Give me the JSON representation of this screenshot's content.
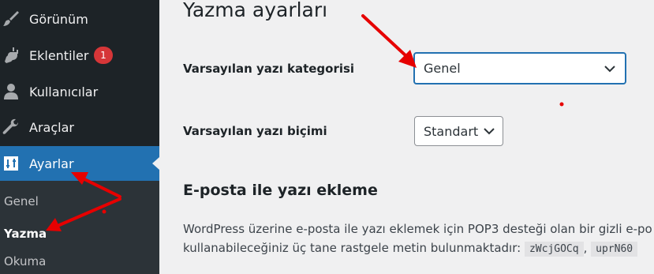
{
  "sidebar": {
    "items": [
      {
        "label": "Görünüm",
        "icon": "paintbrush-icon"
      },
      {
        "label": "Eklentiler",
        "icon": "plugin-icon",
        "badge": "1"
      },
      {
        "label": "Kullanıcılar",
        "icon": "users-icon"
      },
      {
        "label": "Araçlar",
        "icon": "wrench-icon"
      },
      {
        "label": "Ayarlar",
        "icon": "settings-icon",
        "active": true
      }
    ],
    "submenu": [
      "Genel",
      "Yazma",
      "Okuma"
    ],
    "current_submenu": "Yazma"
  },
  "main": {
    "title": "Yazma ayarları",
    "fields": [
      {
        "label": "Varsayılan yazı kategorisi",
        "value": "Genel"
      },
      {
        "label": "Varsayılan yazı biçimi",
        "value": "Standart"
      }
    ],
    "section_title": "E-posta ile yazı ekleme",
    "paragraph": {
      "line1": "WordPress üzerine e-posta ile yazı eklemek için POP3 desteği olan bir gizli e-po",
      "line2_text": "kullanabileceğiniz üç tane rastgele metin bulunmaktadır:",
      "codes": [
        "zWcjGOCq",
        "uprN60"
      ],
      "separator": ","
    }
  },
  "colors": {
    "sidebar_bg": "#1d2327",
    "submenu_bg": "#2c3338",
    "active_bg": "#2271b1",
    "badge_bg": "#d63638",
    "annotation_red": "#e60000"
  }
}
